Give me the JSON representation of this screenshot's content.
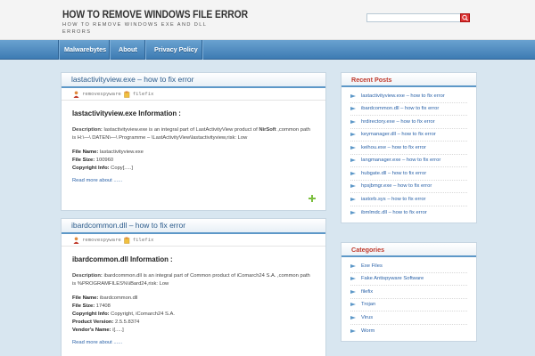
{
  "header": {
    "site_title": "HOW TO REMOVE WINDOWS FILE ERROR",
    "site_description": "HOW TO REMOVE WINDOWS EXE AND DLL ERRORS",
    "search": {
      "placeholder": "",
      "button_icon": "search-icon"
    }
  },
  "nav": {
    "items": [
      {
        "label": "Malwarebytes"
      },
      {
        "label": "About"
      },
      {
        "label": "Privacy Policy"
      }
    ]
  },
  "posts": [
    {
      "title": "lastactivityview.exe – how to fix error",
      "meta_author": "removespyware",
      "meta_category": "filefix",
      "heading": "lastactivityview.exe Information :",
      "desc_label": "Description:",
      "desc_before_bold": " lastactivityview.exe is an integral part of LastActivityView product of ",
      "desc_bold": "NirSoft",
      "desc_after_bold": " ,common path is H:\\—\\ DATEN\\—\\ Programme – \\LastActivityView\\lastactivityview,risk: Low",
      "fields": [
        {
          "label": "File Name:",
          "value": " lastactivityview.exe"
        },
        {
          "label": "File Size:",
          "value": " 100960"
        },
        {
          "label": "Copyright Info:",
          "value": " Copy[.....]"
        }
      ],
      "read_more": "Read more about ......"
    },
    {
      "title": "ibardcommon.dll – how to fix error",
      "meta_author": "removespyware",
      "meta_category": "filefix",
      "heading": "ibardcommon.dll Information :",
      "desc_label": "Description:",
      "desc_text": " ibardcommon.dll is an integral part of Common product of iComarch24 S.A. ,common path is %PROGRAMFILES%\\iBard24,risk: Low",
      "fields": [
        {
          "label": "File Name:",
          "value": " ibardcommon.dll"
        },
        {
          "label": "File Size:",
          "value": " 17408"
        },
        {
          "label": "Copyright Info:",
          "value": " Copyright, iComarch24 S.A."
        },
        {
          "label": "Product Version:",
          "value": " 2.5.5.8374"
        },
        {
          "label": "Vendor's Name:",
          "value": " i[.....]"
        }
      ],
      "read_more": "Read more about ......"
    }
  ],
  "sidebar": {
    "recent_posts": {
      "title": "Recent Posts",
      "items": [
        "lastactivityview.exe – how to fix error",
        "ibardcommon.dll – how to fix error",
        "hrdirectory.exe – how to fix error",
        "keymanager.dll – how to fix error",
        "keihou.exe – how to fix error",
        "langmanager.exe – how to fix error",
        "hubgate.dll – how to fix error",
        "hpsjbmgr.exe – how to fix error",
        "iastorb.sys – how to fix error",
        "ibmlmdc.dll – how to fix error"
      ]
    },
    "categories": {
      "title": "Categories",
      "items": [
        "Exe Files",
        "Fake Antispyware Software",
        "filefix",
        "Trojan",
        "Virus",
        "Worm"
      ]
    }
  },
  "colors": {
    "nav_bar": "#4d8cc2",
    "link": "#2a62a8",
    "widget_title": "#c0392b",
    "page_background": "#d8e6f0"
  }
}
